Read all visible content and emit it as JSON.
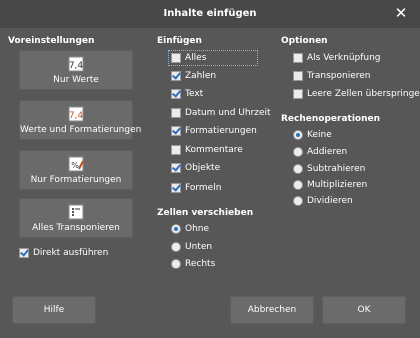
{
  "window": {
    "title": "Inhalte einfügen"
  },
  "presets": {
    "title": "Voreinstellungen",
    "buttons": [
      {
        "label": "Nur Werte",
        "icon": "values-only-icon"
      },
      {
        "label": "Werte und Formatierungen",
        "icon": "values-formatting-icon"
      },
      {
        "label": "Nur Formatierungen",
        "icon": "formatting-only-icon"
      },
      {
        "label": "Alles Transponieren",
        "icon": "transpose-all-icon"
      }
    ],
    "direkt": {
      "label": "Direkt ausführen",
      "checked": true
    }
  },
  "insert": {
    "title": "Einfügen",
    "items": [
      {
        "label": "Alles",
        "checked": false
      },
      {
        "label": "Zahlen",
        "checked": true
      },
      {
        "label": "Text",
        "checked": true
      },
      {
        "label": "Datum und Uhrzeit",
        "checked": false
      },
      {
        "label": "Formatierungen",
        "checked": true
      },
      {
        "label": "Kommentare",
        "checked": false
      },
      {
        "label": "Objekte",
        "checked": true
      },
      {
        "label": "Formeln",
        "checked": true
      }
    ]
  },
  "shift": {
    "title": "Zellen verschieben",
    "options": [
      {
        "label": "Ohne",
        "selected": true
      },
      {
        "label": "Unten",
        "selected": false
      },
      {
        "label": "Rechts",
        "selected": false
      }
    ]
  },
  "options": {
    "title": "Optionen",
    "items": [
      {
        "label": "Als Verknüpfung",
        "checked": false
      },
      {
        "label": "Transponieren",
        "checked": false
      },
      {
        "label": "Leere Zellen überspringen",
        "checked": false
      }
    ]
  },
  "operations": {
    "title": "Rechenoperationen",
    "options": [
      {
        "label": "Keine",
        "selected": true
      },
      {
        "label": "Addieren",
        "selected": false
      },
      {
        "label": "Subtrahieren",
        "selected": false
      },
      {
        "label": "Multiplizieren",
        "selected": false
      },
      {
        "label": "Dividieren",
        "selected": false
      }
    ]
  },
  "footer": {
    "help": "Hilfe",
    "cancel": "Abbrechen",
    "ok": "OK"
  },
  "colors": {
    "accent": "#2f6fc0",
    "background": "#575757",
    "titlebar": "#484848"
  }
}
